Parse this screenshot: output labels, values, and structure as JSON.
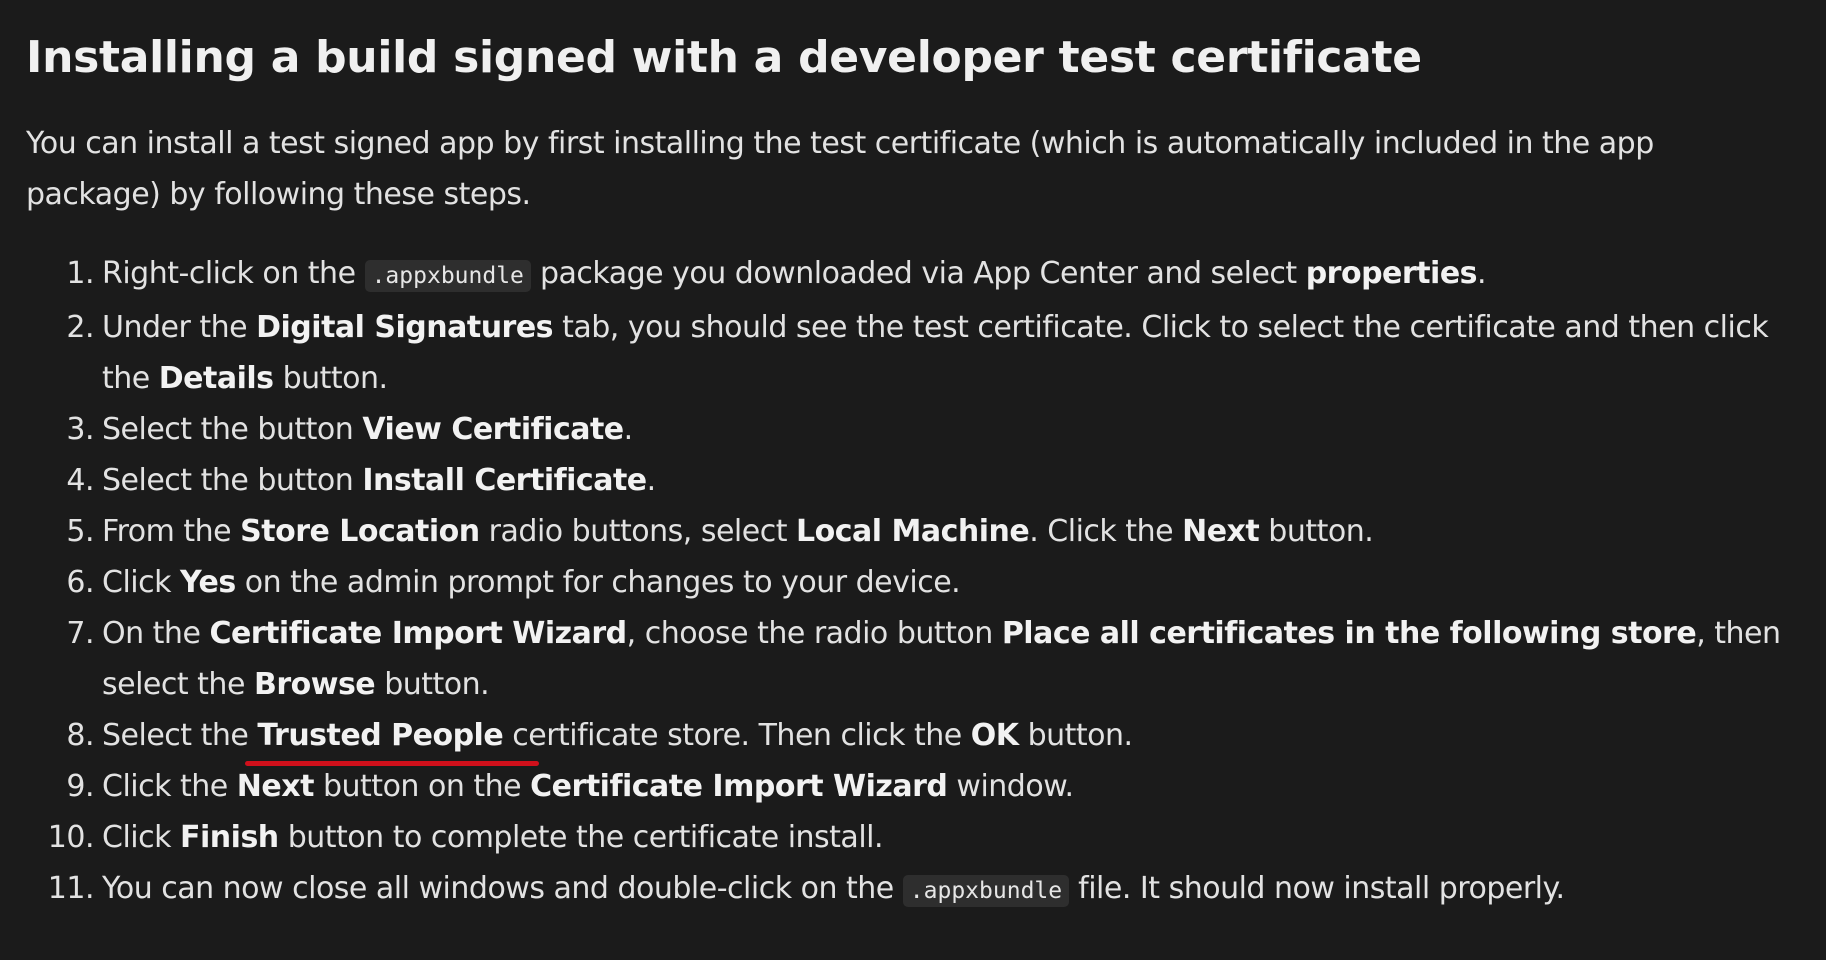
{
  "heading": "Installing a build signed with a developer test certificate",
  "intro": "You can install a test signed app by first installing the test certificate (which is automatically included in the app package) by following these steps.",
  "steps": [
    {
      "num": "1.",
      "parts": [
        {
          "t": "Right-click on the "
        },
        {
          "t": ".appxbundle",
          "code": true
        },
        {
          "t": " package you downloaded via App Center and select "
        },
        {
          "t": "properties",
          "b": true
        },
        {
          "t": "."
        }
      ]
    },
    {
      "num": "2.",
      "parts": [
        {
          "t": "Under the "
        },
        {
          "t": "Digital Signatures",
          "b": true
        },
        {
          "t": " tab, you should see the test certificate. Click to select the certificate and then click the "
        },
        {
          "t": "Details",
          "b": true
        },
        {
          "t": " button."
        }
      ]
    },
    {
      "num": "3.",
      "parts": [
        {
          "t": "Select the button "
        },
        {
          "t": "View Certificate",
          "b": true
        },
        {
          "t": "."
        }
      ]
    },
    {
      "num": "4.",
      "parts": [
        {
          "t": "Select the button "
        },
        {
          "t": "Install Certificate",
          "b": true
        },
        {
          "t": "."
        }
      ]
    },
    {
      "num": "5.",
      "parts": [
        {
          "t": "From the "
        },
        {
          "t": "Store Location",
          "b": true
        },
        {
          "t": " radio buttons, select "
        },
        {
          "t": "Local Machine",
          "b": true
        },
        {
          "t": ". Click the "
        },
        {
          "t": "Next",
          "b": true
        },
        {
          "t": " button."
        }
      ]
    },
    {
      "num": "6.",
      "parts": [
        {
          "t": "Click "
        },
        {
          "t": "Yes",
          "b": true
        },
        {
          "t": " on the admin prompt for changes to your device."
        }
      ]
    },
    {
      "num": "7.",
      "parts": [
        {
          "t": "On the "
        },
        {
          "t": "Certificate Import Wizard",
          "b": true
        },
        {
          "t": ", choose the radio button "
        },
        {
          "t": "Place all certificates in the following store",
          "b": true
        },
        {
          "t": ", then select the "
        },
        {
          "t": "Browse",
          "b": true
        },
        {
          "t": " button."
        }
      ]
    },
    {
      "num": "8.",
      "parts": [
        {
          "t": "Select the "
        },
        {
          "t": "Trusted People",
          "b": true,
          "underline": true
        },
        {
          "t": " certificate store. Then click the "
        },
        {
          "t": "OK",
          "b": true
        },
        {
          "t": " button."
        }
      ]
    },
    {
      "num": "9.",
      "parts": [
        {
          "t": "Click the "
        },
        {
          "t": "Next",
          "b": true
        },
        {
          "t": " button on the "
        },
        {
          "t": "Certificate Import Wizard",
          "b": true
        },
        {
          "t": " window."
        }
      ]
    },
    {
      "num": "10.",
      "parts": [
        {
          "t": "Click "
        },
        {
          "t": "Finish",
          "b": true
        },
        {
          "t": " button to complete the certificate install."
        }
      ]
    },
    {
      "num": "11.",
      "parts": [
        {
          "t": "You can now close all windows and double-click on the "
        },
        {
          "t": ".appxbundle",
          "code": true
        },
        {
          "t": " file. It should now install properly."
        }
      ]
    }
  ],
  "colors": {
    "background": "#1b1b1b",
    "text": "#e2e2e2",
    "code_background": "#2e2e2e",
    "annotation_underline": "#d0101b"
  }
}
